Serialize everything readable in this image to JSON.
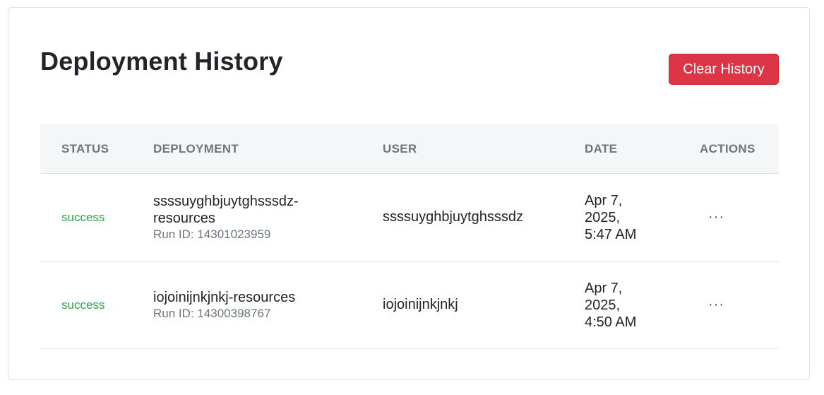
{
  "header": {
    "title": "Deployment History",
    "clear_button_label": "Clear History"
  },
  "colors": {
    "danger": "#dc3545",
    "success": "#28a745",
    "muted": "#6c757d",
    "header_bg": "#f5f6f8"
  },
  "table": {
    "columns": [
      "STATUS",
      "DEPLOYMENT",
      "USER",
      "DATE",
      "ACTIONS"
    ],
    "rows": [
      {
        "status": "success",
        "deployment": "ssssuyghbjuytghsssdz-resources",
        "run_id": "Run ID: 14301023959",
        "user": "ssssuyghbjuytghsssdz",
        "date": "Apr 7, 2025, 5:47 AM",
        "actions": "···"
      },
      {
        "status": "success",
        "deployment": "iojoinijnkjnkj-resources",
        "run_id": "Run ID: 14300398767",
        "user": "iojoinijnkjnkj",
        "date": "Apr 7, 2025, 4:50 AM",
        "actions": "···"
      }
    ]
  }
}
